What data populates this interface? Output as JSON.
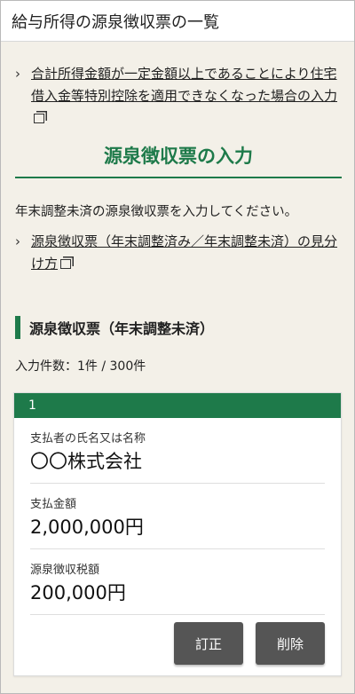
{
  "header": {
    "title": "給与所得の源泉徴収票の一覧"
  },
  "links": {
    "housing_loan": "合計所得金額が一定金額以上であることにより住宅借入金等特別控除を適用できなくなった場合の入力",
    "how_to_tell": "源泉徴収票（年末調整済み／年末調整未済）の見分け方"
  },
  "section": {
    "title": "源泉徴収票の入力",
    "intro": "年末調整未済の源泉徴収票を入力してください。"
  },
  "subsection": {
    "title": "源泉徴収票（年末調整未済）"
  },
  "count_text": "入力件数：1件 / 300件",
  "card": {
    "index": "1",
    "payer_label": "支払者の氏名又は名称",
    "payer_value": "〇〇株式会社",
    "amount_label": "支払金額",
    "amount_value": "2,000,000円",
    "tax_label": "源泉徴収税額",
    "tax_value": "200,000円",
    "edit_button": "訂正",
    "delete_button": "削除"
  },
  "colors": {
    "accent": "#1e7a4a",
    "background": "#f3f0e8",
    "button": "#555555"
  },
  "icons": [
    "chevron-right-icon",
    "external-window-icon"
  ]
}
